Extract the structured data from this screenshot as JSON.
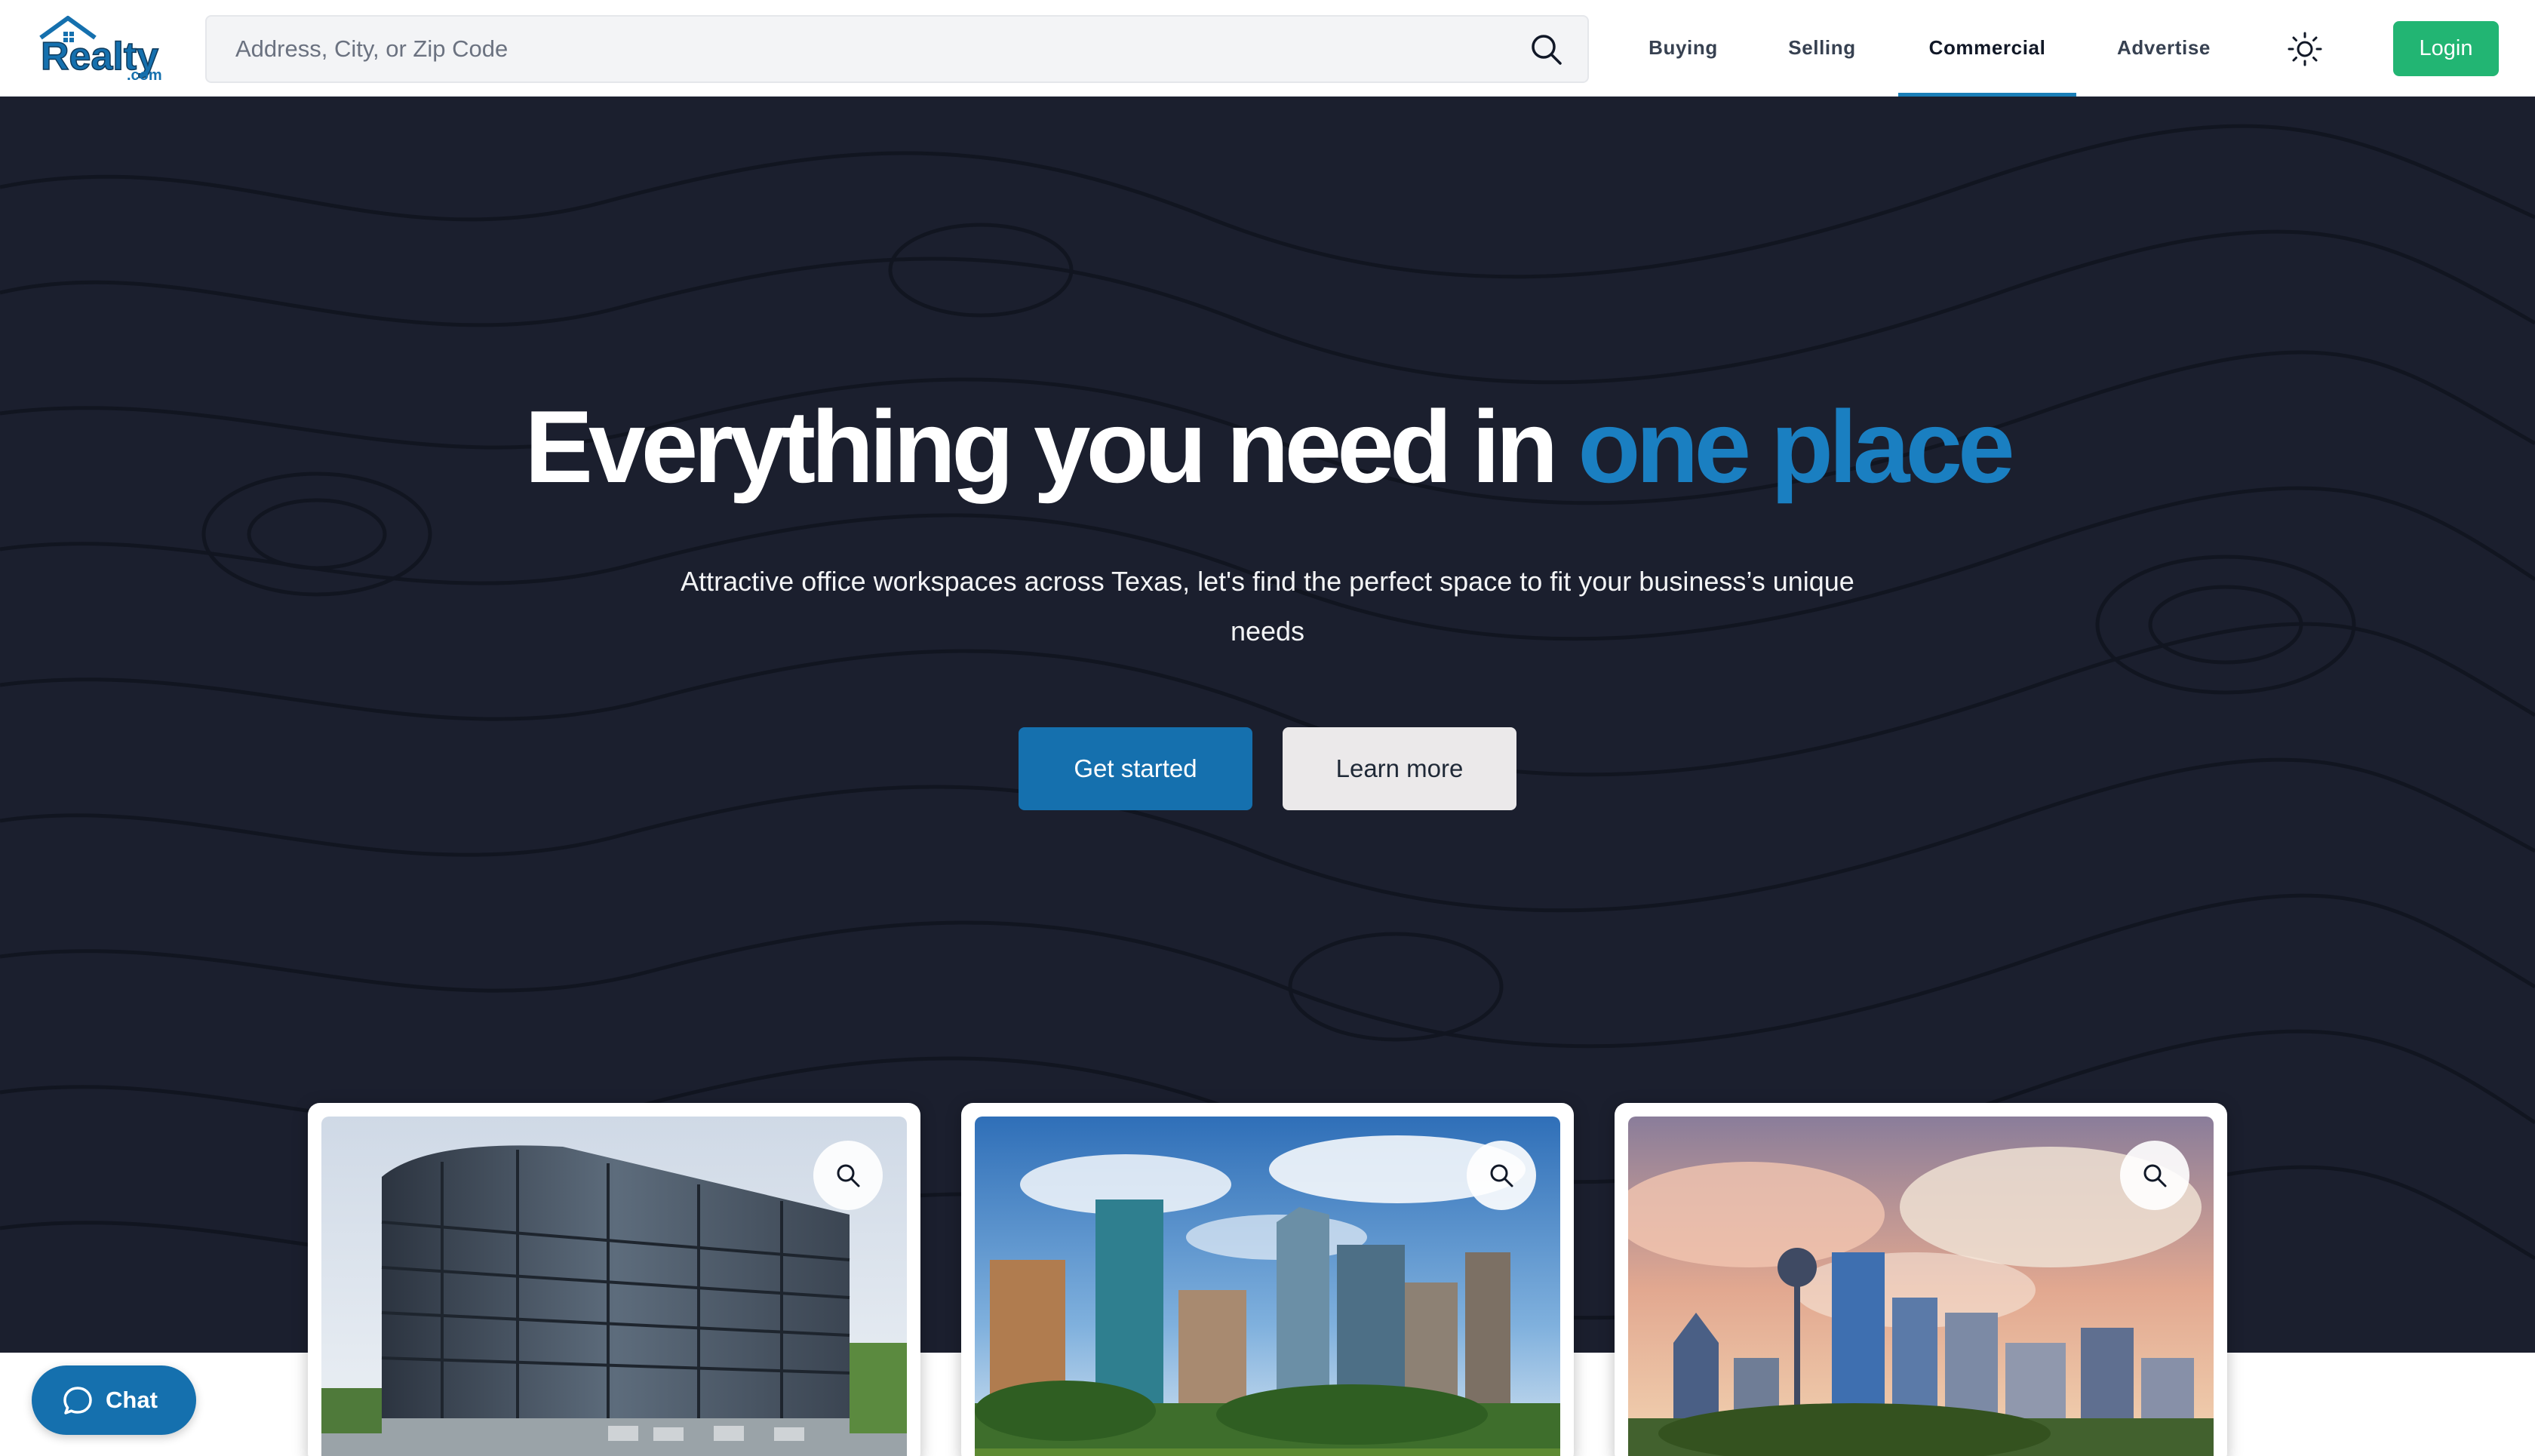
{
  "header": {
    "logo": {
      "text": "Realty",
      "subtext": ".com"
    },
    "search": {
      "placeholder": "Address, City, or Zip Code",
      "value": "",
      "icon": "search-icon"
    },
    "nav": [
      {
        "label": "Buying",
        "active": false
      },
      {
        "label": "Selling",
        "active": false
      },
      {
        "label": "Commercial",
        "active": true
      },
      {
        "label": "Advertise",
        "active": false
      }
    ],
    "theme_toggle_icon": "sun-icon",
    "login_label": "Login"
  },
  "hero": {
    "title_main": "Everything you need in ",
    "title_accent": "one place",
    "subtitle": "Attractive office workspaces across Texas, let's find the perfect space to fit your business’s unique needs",
    "primary_button": "Get started",
    "secondary_button": "Learn more"
  },
  "cards": [
    {
      "image": "office-building-photo",
      "zoom_icon": "zoom-icon"
    },
    {
      "image": "houston-skyline-photo",
      "zoom_icon": "zoom-icon"
    },
    {
      "image": "dallas-skyline-photo",
      "zoom_icon": "zoom-icon"
    }
  ],
  "chat": {
    "label": "Chat",
    "icon": "chat-bubble-icon"
  },
  "colors": {
    "brand_blue": "#1570ae",
    "accent_blue": "#1a7fc1",
    "login_green": "#22b573",
    "hero_bg": "#1b1f2e"
  }
}
